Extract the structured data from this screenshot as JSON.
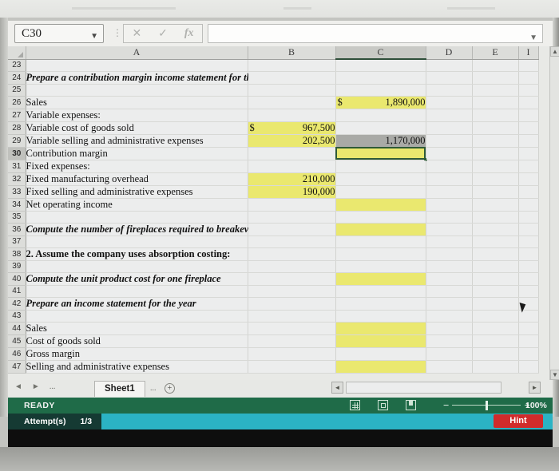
{
  "formula_bar": {
    "name_box_value": "C30",
    "formula_value": "",
    "cancel_icon": "cancel-icon",
    "enter_icon": "enter-icon",
    "fx_label": "fx"
  },
  "grid": {
    "columns": [
      "A",
      "B",
      "C",
      "D",
      "E",
      "I"
    ],
    "active_column": "C",
    "active_row": "30",
    "active_cell": "C30",
    "rows": [
      {
        "n": "23",
        "a": "",
        "b": "",
        "c": "",
        "d": "",
        "e": ""
      },
      {
        "n": "24",
        "a": "Prepare a contribution margin income statement for the year",
        "a_style": "ital",
        "b": "",
        "c": "",
        "d": "",
        "e": ""
      },
      {
        "n": "25",
        "a": "",
        "b": "",
        "c": "",
        "d": "",
        "e": ""
      },
      {
        "n": "26",
        "a": "Sales",
        "b": "",
        "c_dollar": "$",
        "c": "1,890,000",
        "c_fill": "yellow",
        "d": "",
        "e": ""
      },
      {
        "n": "27",
        "a": "Variable expenses:",
        "b": "",
        "c": "",
        "d": "",
        "e": ""
      },
      {
        "n": "28",
        "a": "Variable cost of goods sold",
        "a_indent": true,
        "b_dollar": "$",
        "b": "967,500",
        "b_fill": "yellow",
        "c": "",
        "d": "",
        "e": ""
      },
      {
        "n": "29",
        "a": "Variable selling and administrative expenses",
        "a_indent": true,
        "b": "202,500",
        "b_fill": "yellow",
        "c": "1,170,000",
        "c_fill": "grey",
        "d": "",
        "e": ""
      },
      {
        "n": "30",
        "a": "Contribution margin",
        "b": "",
        "b_topborder": true,
        "c": "",
        "c_fill": "active",
        "d": "",
        "e": ""
      },
      {
        "n": "31",
        "a": "Fixed expenses:",
        "b": "",
        "c": "",
        "d": "",
        "e": ""
      },
      {
        "n": "32",
        "a": "Fixed manufacturing overhead",
        "a_indent": true,
        "b": "210,000",
        "b_fill": "yellow",
        "c": "",
        "d": "",
        "e": ""
      },
      {
        "n": "33",
        "a": "Fixed selling and administrative expenses",
        "a_indent": true,
        "b": "190,000",
        "b_fill": "yellow",
        "c": "",
        "d": "",
        "e": ""
      },
      {
        "n": "34",
        "a": "Net operating income",
        "b": "",
        "b_topborder": true,
        "c": "",
        "c_fill": "yellow",
        "d": "",
        "e": ""
      },
      {
        "n": "35",
        "a": "",
        "b": "",
        "c": "",
        "c_topborder": true,
        "d": "",
        "e": ""
      },
      {
        "n": "36",
        "a": "Compute the number of fireplaces required to breakeven",
        "a_style": "ital",
        "b": "",
        "c": "",
        "c_fill": "yellow",
        "d": "",
        "e": ""
      },
      {
        "n": "37",
        "a": "",
        "b": "",
        "c": "",
        "d": "",
        "e": ""
      },
      {
        "n": "38",
        "a": "2. Assume the company uses absorption costing:",
        "a_style": "bold",
        "b": "",
        "c": "",
        "d": "",
        "e": ""
      },
      {
        "n": "39",
        "a": "",
        "b": "",
        "c": "",
        "d": "",
        "e": ""
      },
      {
        "n": "40",
        "a": "Compute the unit product cost for one fireplace",
        "a_style": "ital",
        "b": "",
        "c": "",
        "c_fill": "yellow",
        "d": "",
        "e": ""
      },
      {
        "n": "41",
        "a": "",
        "b": "",
        "c": "",
        "d": "",
        "e": ""
      },
      {
        "n": "42",
        "a": "Prepare an income statement for the year",
        "a_style": "ital",
        "b": "",
        "c": "",
        "d": "",
        "e": ""
      },
      {
        "n": "43",
        "a": "",
        "b": "",
        "c": "",
        "d": "",
        "e": ""
      },
      {
        "n": "44",
        "a": "Sales",
        "b": "",
        "c": "",
        "c_fill": "yellow",
        "d": "",
        "e": ""
      },
      {
        "n": "45",
        "a": "Cost of goods sold",
        "b": "",
        "c": "",
        "c_fill": "yellow",
        "d": "",
        "e": ""
      },
      {
        "n": "46",
        "a": "Gross margin",
        "b": "",
        "c": "",
        "c_topborder": true,
        "d": "",
        "e": ""
      },
      {
        "n": "47",
        "a": "Selling and administrative expenses",
        "b": "",
        "c": "",
        "c_fill": "yellow",
        "d": "",
        "e": ""
      }
    ]
  },
  "tab_bar": {
    "first_arrow": "◄",
    "next_arrow": "►",
    "left_dots": "...",
    "sheet_name": "Sheet1",
    "right_dots": "...",
    "add_sheet": "+",
    "hscroll_left": "◄",
    "hscroll_right": "►"
  },
  "status_bar": {
    "state": "READY",
    "view_normal_icon": "normal-view-icon",
    "view_layout_icon": "page-layout-icon",
    "view_break_icon": "page-break-icon",
    "zoom_out": "−",
    "zoom_in": "+",
    "zoom_level": "100%"
  },
  "attempt_bar": {
    "label": "Attempt(s)",
    "count": "1/3",
    "hint_label": "Hint"
  },
  "colors": {
    "status_green": "#1f6b48",
    "attempt_teal": "#2bb3c4",
    "hint_red": "#d12b2b",
    "cell_yellow": "#eae86f",
    "selection_grey": "#a9aaa6"
  }
}
